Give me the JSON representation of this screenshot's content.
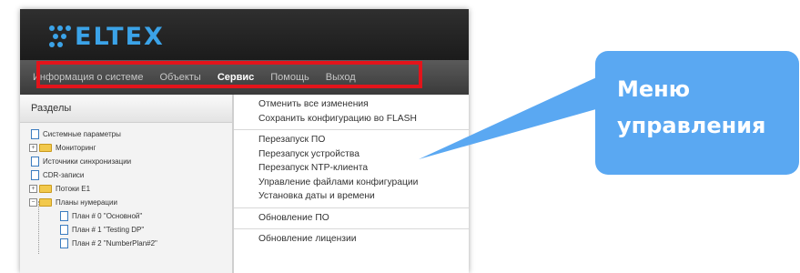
{
  "brand": {
    "logo_text": "ELTEX",
    "accent": "#3ba3e8"
  },
  "menu": {
    "items": [
      {
        "label": "Информация о системе",
        "active": false
      },
      {
        "label": "Объекты",
        "active": false
      },
      {
        "label": "Сервис",
        "active": true
      },
      {
        "label": "Помощь",
        "active": false
      },
      {
        "label": "Выход",
        "active": false
      }
    ],
    "highlight_color": "#e3141b"
  },
  "sidebar": {
    "title": "Разделы",
    "items": [
      {
        "label": "Системные параметры",
        "icon": "document-icon"
      },
      {
        "label": "Мониторинг",
        "icon": "folder-icon",
        "expander": "+"
      },
      {
        "label": "Источники синхронизации",
        "icon": "document-icon"
      },
      {
        "label": "CDR-записи",
        "icon": "document-icon"
      },
      {
        "label": "Потоки E1",
        "icon": "folder-icon",
        "expander": "+"
      },
      {
        "label": "Планы нумерации",
        "icon": "folder-icon",
        "expander": "−"
      },
      {
        "label": "План # 0 \"Основной\"",
        "icon": "document-icon"
      },
      {
        "label": "План # 1 \"Testing DP\"",
        "icon": "document-icon"
      },
      {
        "label": "План # 2 \"NumberPlan#2\"",
        "icon": "document-icon"
      }
    ]
  },
  "dropdown": {
    "groups": [
      [
        "Отменить все изменения",
        "Сохранить конфигурацию во FLASH"
      ],
      [
        "Перезапуск ПО",
        "Перезапуск устройства",
        "Перезапуск NTP-клиента",
        "Управление файлами конфигурации",
        "Установка даты и времени"
      ],
      [
        "Обновление ПО"
      ],
      [
        "Обновление лицензии"
      ]
    ]
  },
  "callout": {
    "line1": "Меню",
    "line2": "управления",
    "color": "#5aa8f2"
  }
}
